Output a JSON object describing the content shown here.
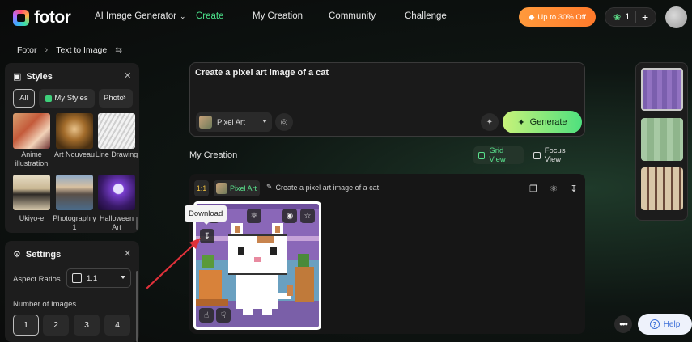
{
  "brand": {
    "name": "fotor"
  },
  "nav": {
    "ai_generator": "AI Image Generator",
    "create": "Create",
    "my_creation": "My Creation",
    "community": "Community",
    "challenge": "Challenge"
  },
  "promo": {
    "label": "Up to 30% Off"
  },
  "credits": {
    "count": "1"
  },
  "breadcrumb": {
    "root": "Fotor",
    "current": "Text to Image"
  },
  "styles": {
    "title": "Styles",
    "filters": {
      "all": "All",
      "my_styles": "My Styles",
      "photo": "Photo"
    },
    "items": [
      {
        "label": "Anime illustration"
      },
      {
        "label": "Art Nouveau"
      },
      {
        "label": "Line Drawing"
      },
      {
        "label": "Ukiyo-e"
      },
      {
        "label": "Photograph y 1"
      },
      {
        "label": "Halloween Art"
      }
    ]
  },
  "settings": {
    "title": "Settings",
    "aspect_label": "Aspect Ratios",
    "aspect_value": "1:1",
    "num_label": "Number of Images",
    "num_options": [
      "1",
      "2",
      "3",
      "4"
    ]
  },
  "prompt": {
    "text": "Create a pixel art image of a cat",
    "style": "Pixel Art",
    "generate": "Generate"
  },
  "creation": {
    "title": "My Creation",
    "grid_view": "Grid View",
    "focus_view": "Focus View",
    "ratio": "1:1",
    "style": "Pixel Art",
    "prompt": "Create a pixel art image of a cat",
    "overlay_pill": "t",
    "tooltip": "Download"
  },
  "help": {
    "label": "Help"
  },
  "colors": {
    "accent": "#4be08a",
    "promo": "#ff8a30",
    "arrow": "#e0313a"
  }
}
